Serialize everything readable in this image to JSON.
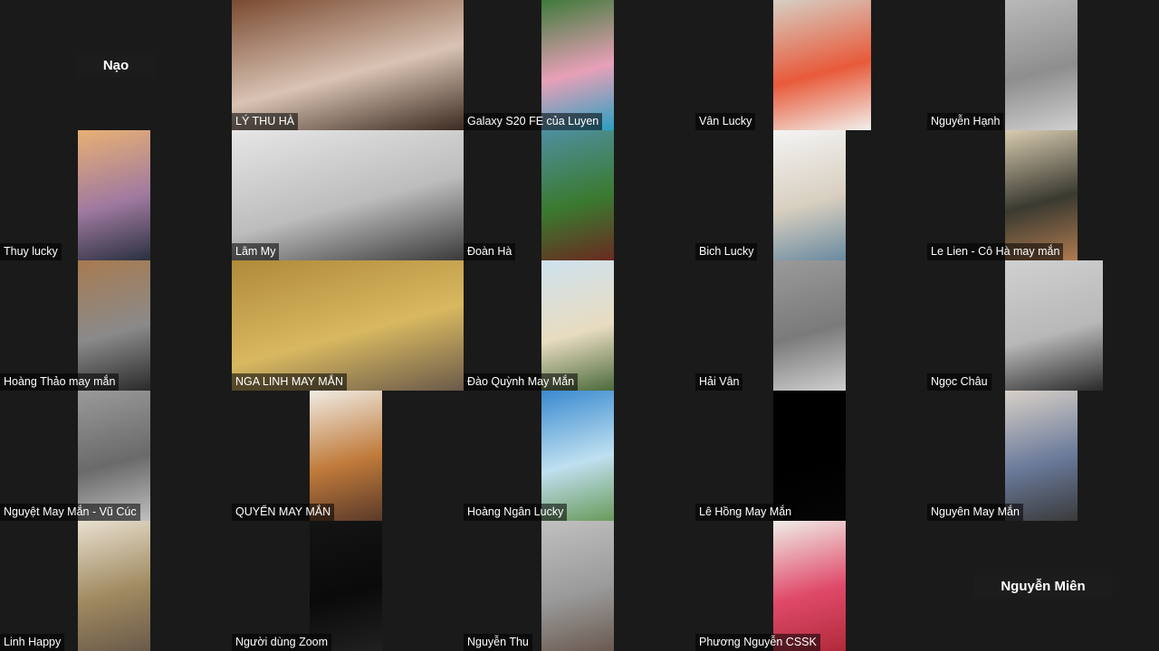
{
  "meeting": {
    "participants": [
      {
        "name": "Nạo",
        "display": "name-only",
        "video": null
      },
      {
        "name": "LÝ THU HÀ",
        "display": "video",
        "video": {
          "fit": "full",
          "colors": [
            "#7a4a30",
            "#d9c3b4",
            "#3b2a20"
          ]
        }
      },
      {
        "name": "Galaxy S20 FE của Luyen",
        "display": "video",
        "video": {
          "fit": "center",
          "colors": [
            "#3f7a3a",
            "#e8a0b8",
            "#2a9fc2"
          ]
        }
      },
      {
        "name": "Vân Lucky",
        "display": "video",
        "video": {
          "fit": "wide",
          "colors": [
            "#d6cfc4",
            "#e85a3a",
            "#f2f0ec"
          ]
        }
      },
      {
        "name": "Nguyễn Hạnh",
        "display": "video",
        "video": {
          "fit": "center",
          "colors": [
            "#b9b9b9",
            "#8e8e8e",
            "#d0d0d0"
          ]
        }
      },
      {
        "name": "Thuy lucky",
        "display": "video",
        "video": {
          "fit": "center",
          "colors": [
            "#e8b074",
            "#a07aa0",
            "#2a3040"
          ]
        }
      },
      {
        "name": "Lâm My",
        "display": "video",
        "video": {
          "fit": "full",
          "colors": [
            "#e6e6e6",
            "#bdbdbd",
            "#3a3a3a"
          ]
        }
      },
      {
        "name": "Đoàn Hà",
        "display": "video",
        "video": {
          "fit": "center",
          "colors": [
            "#4f8fa0",
            "#3a7a30",
            "#6a2a20"
          ]
        }
      },
      {
        "name": "Bich Lucky",
        "display": "video",
        "video": {
          "fit": "center",
          "colors": [
            "#f4f4f4",
            "#d8cfc0",
            "#6a8aa0"
          ]
        }
      },
      {
        "name": "Le Lien - Cô Hà may mắn",
        "display": "video",
        "video": {
          "fit": "center",
          "colors": [
            "#d8cbb0",
            "#3a3a30",
            "#b07a50"
          ]
        }
      },
      {
        "name": "Hoàng Thảo may mắn",
        "display": "video",
        "video": {
          "fit": "center",
          "colors": [
            "#a87a50",
            "#8a8a8a",
            "#2a2a2a"
          ]
        }
      },
      {
        "name": "NGA LINH MAY MẮN",
        "display": "video",
        "video": {
          "fit": "full",
          "colors": [
            "#b08a3a",
            "#d8b860",
            "#6a5a4a"
          ]
        }
      },
      {
        "name": "Đào Quỳnh May Mắn",
        "display": "video",
        "video": {
          "fit": "center",
          "colors": [
            "#cfe2ef",
            "#e8dcc0",
            "#4a6a3a"
          ]
        }
      },
      {
        "name": "Hải Vân",
        "display": "video",
        "video": {
          "fit": "center",
          "colors": [
            "#9a9a9a",
            "#7a7a7a",
            "#cfcfcf"
          ]
        }
      },
      {
        "name": "Ngọc Châu",
        "display": "video",
        "video": {
          "fit": "wide",
          "colors": [
            "#d0d0d0",
            "#b8b8b8",
            "#2a2a2a"
          ]
        }
      },
      {
        "name": "Nguyệt May Mắn - Vũ Cúc",
        "display": "video",
        "video": {
          "fit": "center",
          "colors": [
            "#9a9a9a",
            "#6a6a6a",
            "#bfbfbf"
          ]
        }
      },
      {
        "name": "QUYỂN MAY MẮN",
        "display": "video",
        "video": {
          "fit": "center",
          "colors": [
            "#f0ece4",
            "#c07a3a",
            "#5a3a2a"
          ]
        }
      },
      {
        "name": "Hoàng Ngân Lucky",
        "display": "video",
        "video": {
          "fit": "center",
          "colors": [
            "#3a8ad0",
            "#bfe0f0",
            "#6a9a5a"
          ]
        }
      },
      {
        "name": "Lê Hồng May Mắn",
        "display": "video",
        "video": {
          "fit": "center",
          "colors": [
            "#000000",
            "#000000",
            "#050505"
          ]
        }
      },
      {
        "name": "Nguyên May Mắn",
        "display": "video",
        "video": {
          "fit": "center",
          "colors": [
            "#d8d0c8",
            "#6a7a9a",
            "#3a3a3a"
          ]
        }
      },
      {
        "name": "Linh Happy",
        "display": "video",
        "video": {
          "fit": "center",
          "colors": [
            "#e8e0d0",
            "#a08a60",
            "#6a5a4a"
          ]
        }
      },
      {
        "name": "Người dùng Zoom",
        "display": "video",
        "video": {
          "fit": "center",
          "colors": [
            "#141414",
            "#0a0a0a",
            "#202020"
          ]
        }
      },
      {
        "name": "Nguyễn Thu",
        "display": "video",
        "video": {
          "fit": "center",
          "colors": [
            "#c0c0c0",
            "#9a9a9a",
            "#6a5a50"
          ]
        }
      },
      {
        "name": "Phương Nguyễn CSSK",
        "display": "video",
        "video": {
          "fit": "center",
          "colors": [
            "#f0eee8",
            "#e04a6a",
            "#b02a3a"
          ]
        }
      },
      {
        "name": "Nguyễn Miên",
        "display": "name-only",
        "video": null
      }
    ]
  }
}
